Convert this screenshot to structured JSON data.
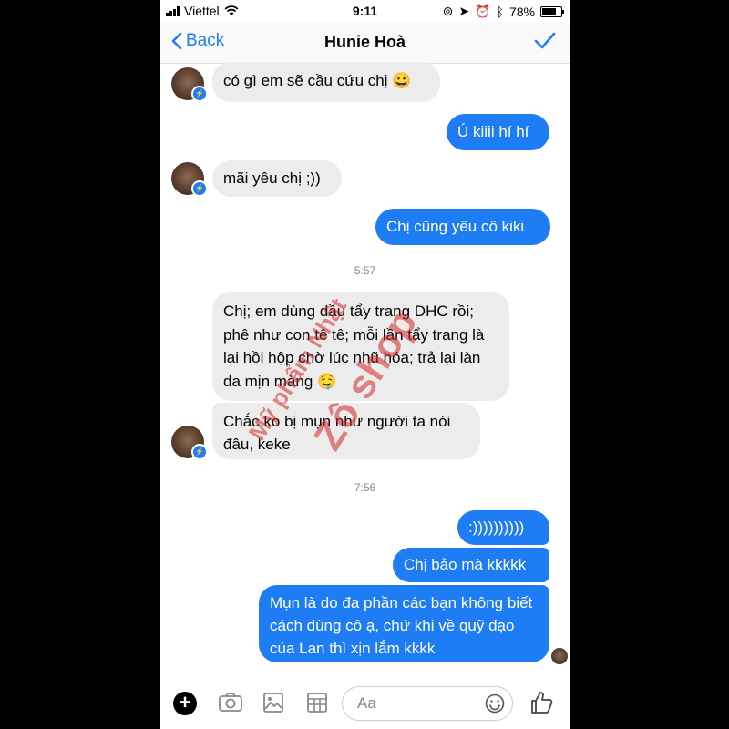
{
  "status": {
    "carrier": "Viettel",
    "time": "9:11",
    "battery": "78%"
  },
  "nav": {
    "back_label": "Back",
    "title": "Hunie Hoà"
  },
  "messages": [
    {
      "text": "có gì em sẽ cầu cứu chị 😀",
      "type": "received"
    },
    {
      "text": "Ú kiiii hí hí",
      "type": "sent"
    },
    {
      "text": "mãi yêu chị ;))",
      "type": "received"
    },
    {
      "text": "Chị cũng yêu cô kiki",
      "type": "sent"
    },
    {
      "text": "Chị; em dùng dầu tẩy trang DHC rồi; phê như con tê tê; mỗi lần tẩy trang là lại hồi hộp chờ lúc nhũ hóa; trả lại làn da mịn màng 🤤",
      "type": "received"
    },
    {
      "text": "Chắc ko bị mụn như người ta nói đâu, keke",
      "type": "received"
    },
    {
      "text": ":))))))))))",
      "type": "sent"
    },
    {
      "text": "Chị bảo mà kkkkk",
      "type": "sent"
    },
    {
      "text": "Mụn là do đa phần các bạn không biết cách dùng cô ạ, chứ khi về quỹ đạo của Lan thì xịn lắm kkkk",
      "type": "sent"
    }
  ],
  "timestamps": [
    "5:57",
    "7:56"
  ],
  "watermark": {
    "line1": "Mỹ phẩm Nhật",
    "line2": "Zô shop"
  },
  "composer": {
    "placeholder": "Aa"
  },
  "colors": {
    "accent": "#1e7cf5",
    "received_bubble": "#ececec",
    "watermark": "#d62828"
  }
}
